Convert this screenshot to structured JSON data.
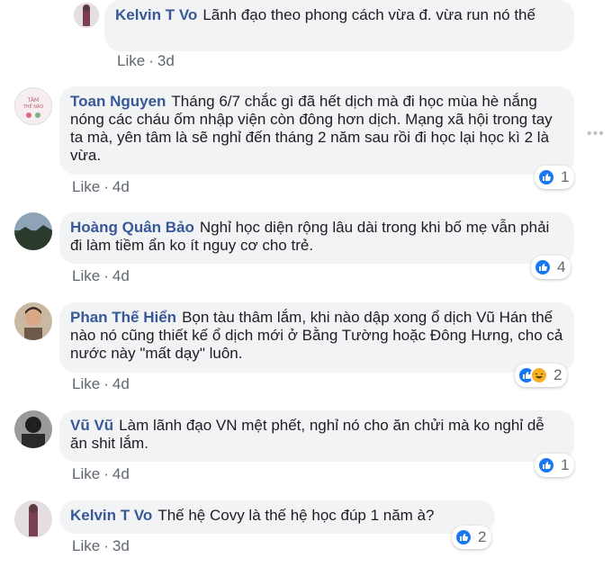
{
  "comments": [
    {
      "name": "Kelvin T Vo",
      "text": "Lãnh đạo theo phong cách vừa đ. vừa run nó thế",
      "like_label": "Like",
      "time": "3d"
    },
    {
      "name": "Toan Nguyen",
      "text": "Tháng 6/7 chắc gì đã hết dịch mà đi học mùa hè nắng nóng các cháu ốm nhập viện còn đông hơn dịch. Mạng xã hội trong tay ta mà, yên tâm là sẽ nghỉ đến tháng 2 năm sau rồi đi học lại học kì 2 là vừa.",
      "like_label": "Like",
      "time": "4d",
      "reaction_count": "1"
    },
    {
      "name": "Hoàng Quân Bảo",
      "text": "Nghỉ học diện rộng lâu dài trong khi bố mẹ vẫn phải đi làm tiềm ẩn ko ít nguy cơ cho trẻ.",
      "like_label": "Like",
      "time": "4d",
      "reaction_count": "4"
    },
    {
      "name": "Phan Thế Hiển",
      "text": "Bọn tàu thâm lắm, khi nào dập xong ổ dịch Vũ Hán thế nào nó cũng thiết kế ổ dịch mới ở Bằng Tường hoặc Đông Hưng, cho cả nước này \"mất dạy\" luôn.",
      "like_label": "Like",
      "time": "4d",
      "reaction_count": "2"
    },
    {
      "name": "Vũ Vũ",
      "text": "Làm lãnh đạo VN mệt phết, nghỉ nó cho ăn chửi mà ko nghỉ dễ ăn shit lắm.",
      "like_label": "Like",
      "time": "4d",
      "reaction_count": "1"
    },
    {
      "name": "Kelvin T Vo",
      "text": "Thế hệ Covy là thế hệ học đúp 1 năm à?",
      "like_label": "Like",
      "time": "3d",
      "reaction_count": "2"
    }
  ],
  "avatar_text": "TÂM THẾ NÀO",
  "colors": {
    "link": "#385898",
    "bubble": "#f2f3f5",
    "like_blue": "#1877f2",
    "meta": "#606770"
  }
}
